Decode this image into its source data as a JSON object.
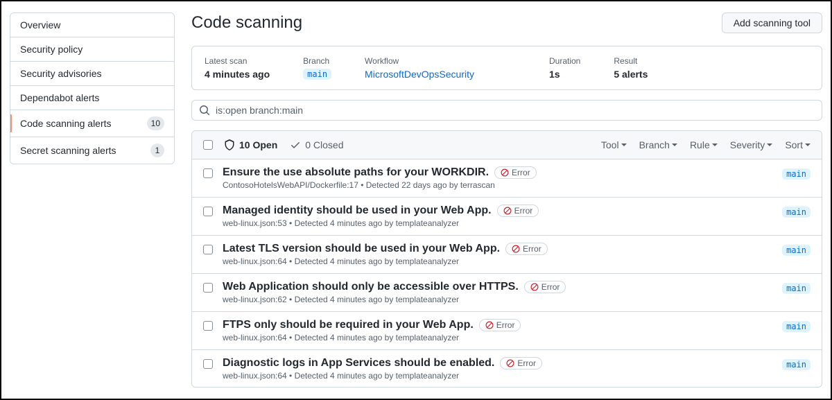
{
  "sidebar": {
    "items": [
      {
        "label": "Overview"
      },
      {
        "label": "Security policy"
      },
      {
        "label": "Security advisories"
      },
      {
        "label": "Dependabot alerts"
      },
      {
        "label": "Code scanning alerts",
        "count": "10",
        "active": true
      },
      {
        "label": "Secret scanning alerts",
        "count": "1"
      }
    ]
  },
  "header": {
    "title": "Code scanning",
    "add_button": "Add scanning tool"
  },
  "summary": {
    "latest_scan_label": "Latest scan",
    "latest_scan_value": "4 minutes ago",
    "branch_label": "Branch",
    "branch_value": "main",
    "workflow_label": "Workflow",
    "workflow_value": "MicrosoftDevOpsSecurity",
    "duration_label": "Duration",
    "duration_value": "1s",
    "result_label": "Result",
    "result_value": "5 alerts"
  },
  "search": {
    "value": "is:open branch:main"
  },
  "table_header": {
    "open_label": "10 Open",
    "closed_label": "0 Closed",
    "filters": [
      "Tool",
      "Branch",
      "Rule",
      "Severity",
      "Sort"
    ]
  },
  "error_label": "Error",
  "branch_pill": "main",
  "alerts": [
    {
      "title": "Ensure the use absolute paths for your WORKDIR.",
      "meta": "ContosoHotelsWebAPI/Dockerfile:17 • Detected 22 days ago by terrascan"
    },
    {
      "title": "Managed identity should be used in your Web App.",
      "meta": "web-linux.json:53 • Detected 4 minutes ago by templateanalyzer"
    },
    {
      "title": "Latest TLS version should be used in your Web App.",
      "meta": "web-linux.json:64 • Detected 4 minutes ago by templateanalyzer"
    },
    {
      "title": "Web Application should only be accessible over HTTPS.",
      "meta": "web-linux.json:62 • Detected 4 minutes ago by templateanalyzer"
    },
    {
      "title": "FTPS only should be required in your Web App.",
      "meta": "web-linux.json:64 • Detected 4 minutes ago by templateanalyzer"
    },
    {
      "title": "Diagnostic logs in App Services should be enabled.",
      "meta": "web-linux.json:64 • Detected 4 minutes ago by templateanalyzer"
    }
  ]
}
